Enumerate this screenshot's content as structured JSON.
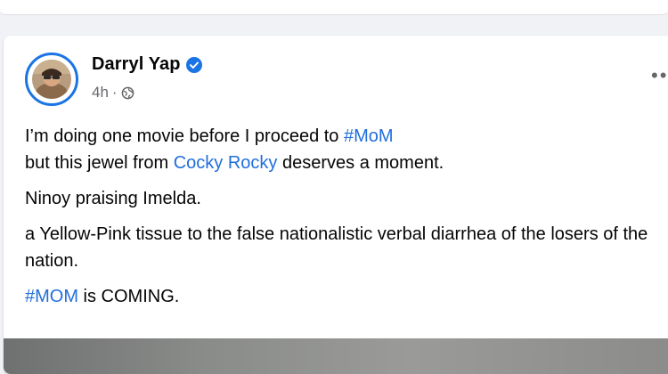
{
  "post": {
    "author_name": "Darryl Yap",
    "timestamp": "4h",
    "separator": "·",
    "more_label": "•••",
    "body": {
      "line1_text": "I’m doing one movie before I proceed to ",
      "line1_hashtag": "#MoM",
      "line2_pre": "but this jewel from ",
      "line2_link": "Cocky Rocky",
      "line2_post": " deserves a moment.",
      "p2": "Ninoy praising Imelda.",
      "p3": "a Yellow-Pink tissue to the false nationalistic verbal diarrhea of the losers of the nation.",
      "p4_hashtag": "#MOM",
      "p4_text": " is COMING."
    }
  },
  "icons": {
    "verified": "verified-badge-icon",
    "audience": "globe-icon",
    "more": "more-options-icon"
  },
  "colors": {
    "link": "#216fdb",
    "verified": "#1b74e4",
    "meta": "#65676b"
  }
}
